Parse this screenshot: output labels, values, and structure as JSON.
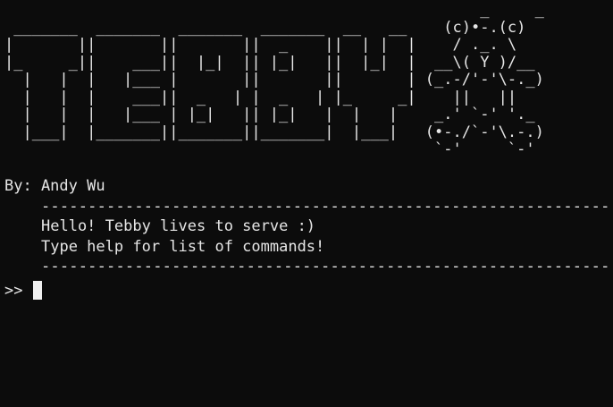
{
  "banner": {
    "ascii_art": "                                                    _     _\n _______  _______  _______  _______  __   __    (c)•-.(c)\n|       ||       ||       ||  _    ||  | |  |    / ._. \\\n|_     _||    ___||  |_|  || |_|   ||  |_|  |  __\\( Y )/__\n  |   |  |   |___ |       ||       ||       | (_.-/'-'\\-._)\n  |   |  |    ___||  _   | |  _   | |_     _|    ||   ||\n  |   |  |   |___ | |_|   || |_|   |  |   |    _.' `-' '._\n  |___|  |_______||_______||_______|  |___|   (•-./`-'\\.-.)\n                                               `-'     `-'"
  },
  "author_line": "By: Andy Wu",
  "divider": "--------------------------------------------------------------------",
  "messages": [
    "Hello! Tebby lives to serve :)",
    "Type help for list of commands!"
  ],
  "prompt": {
    "symbol": ">>",
    "input_value": ""
  }
}
